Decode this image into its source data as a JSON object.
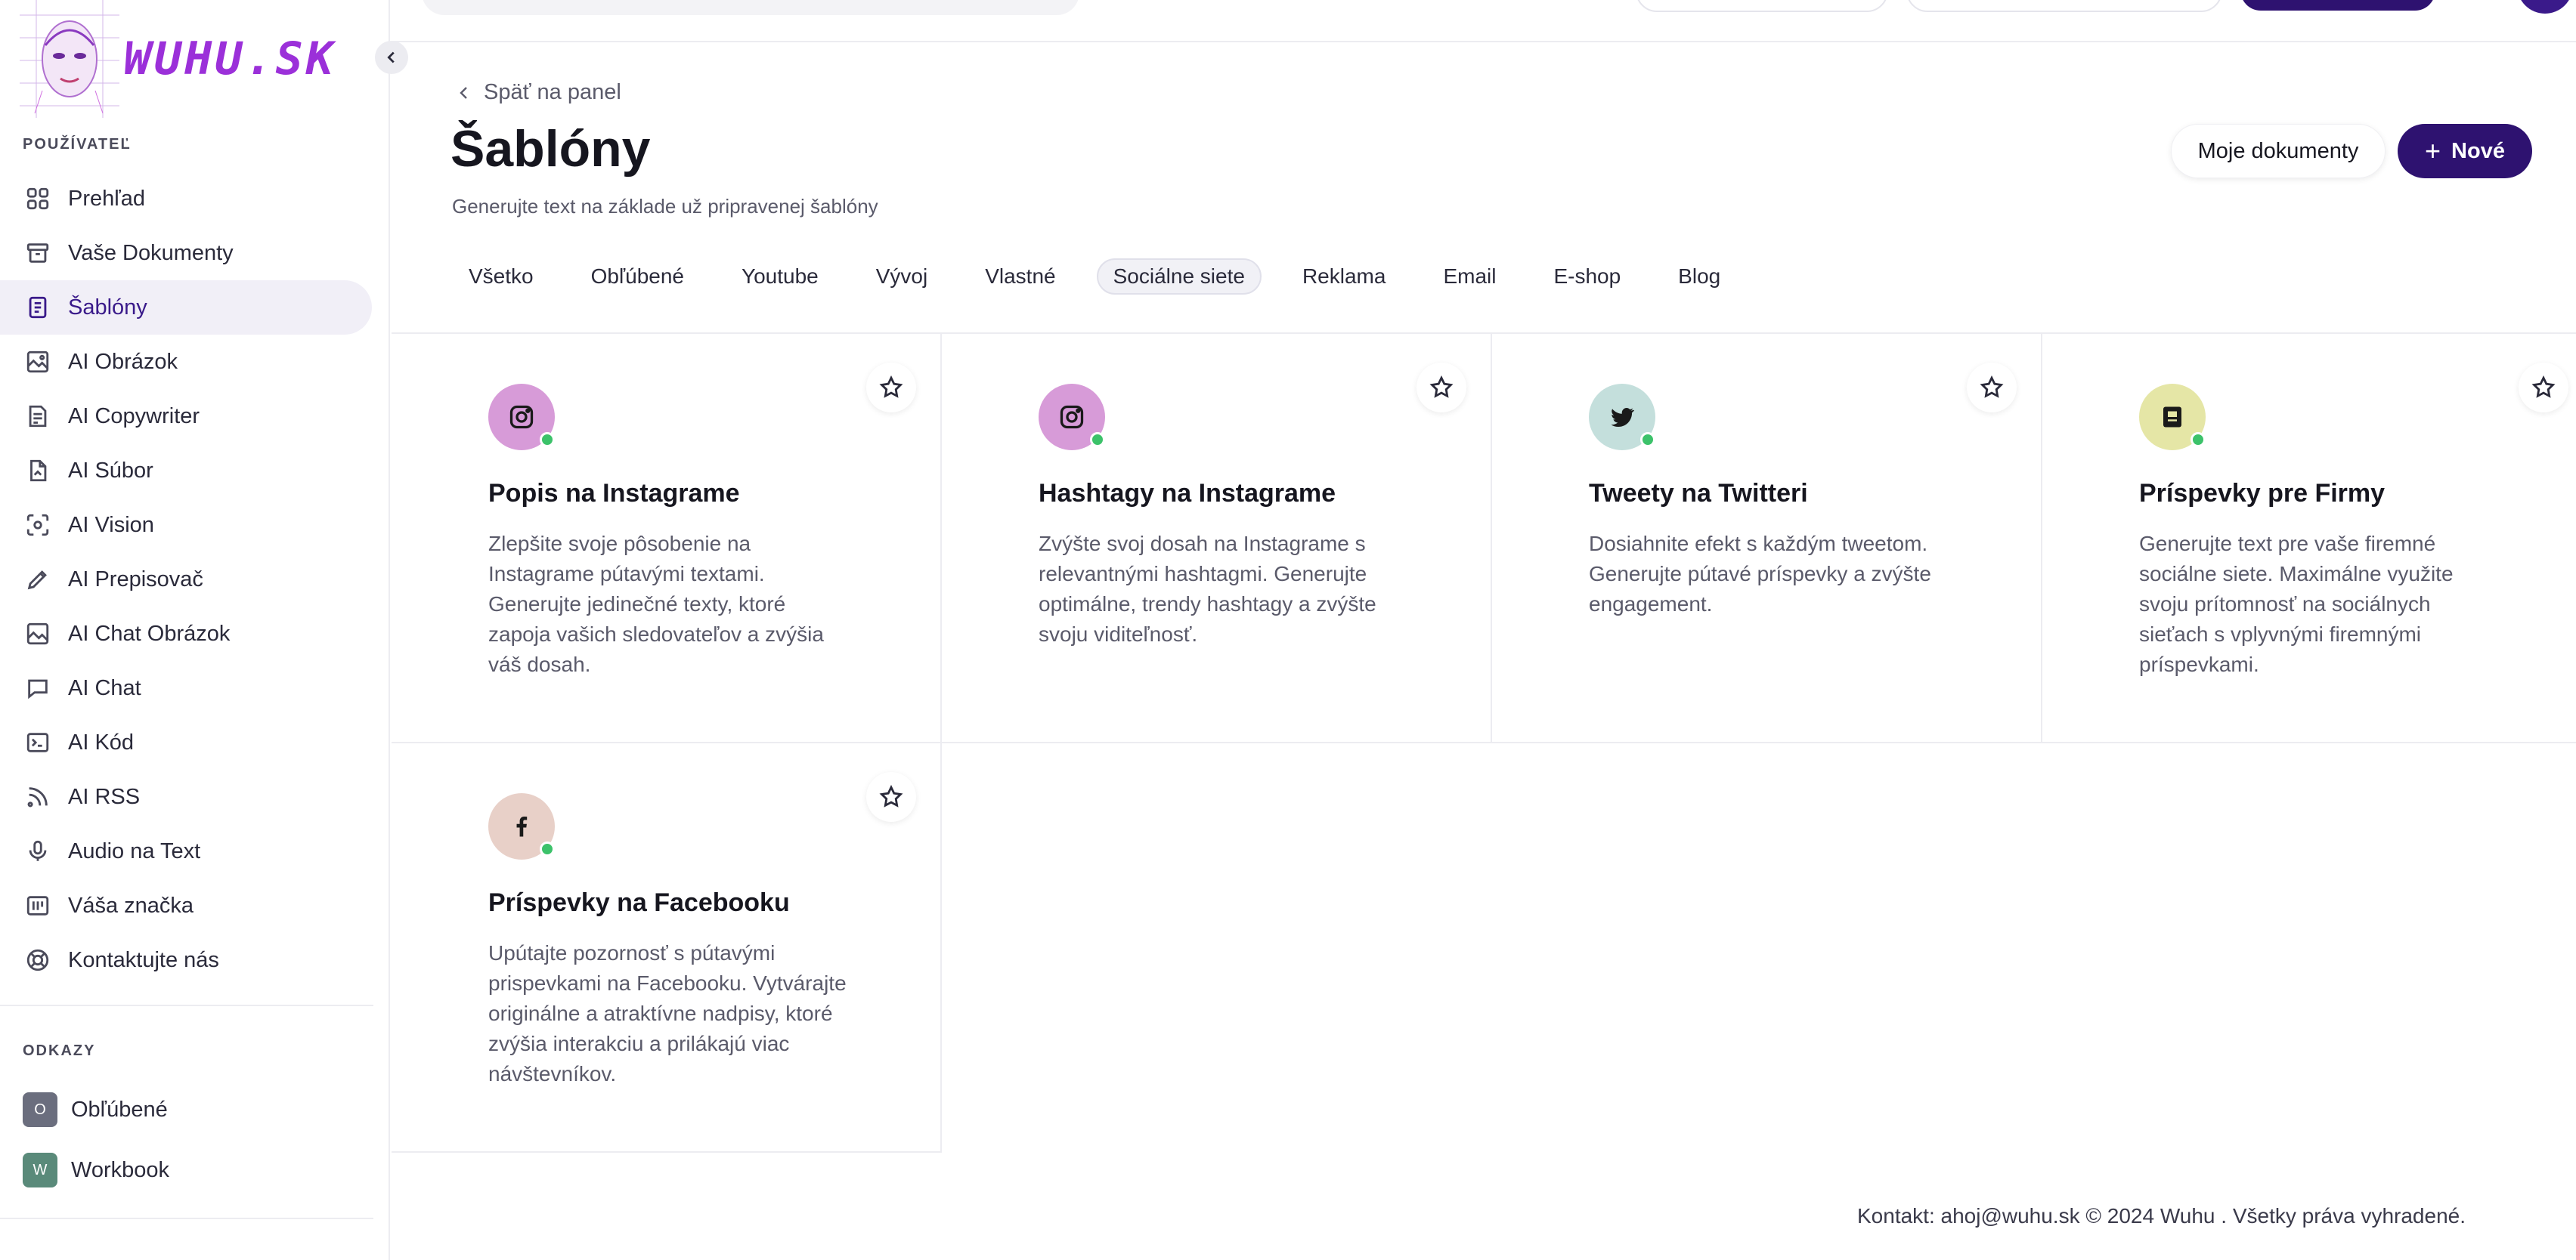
{
  "brand": {
    "logo_text": "WUHU.SK",
    "accent": "#9b30d9",
    "primary": "#2e1270"
  },
  "sidebar": {
    "section_user": "POUŽÍVATEĽ",
    "items": [
      {
        "label": "Prehľad",
        "icon": "dashboard-icon"
      },
      {
        "label": "Vaše Dokumenty",
        "icon": "archive-icon"
      },
      {
        "label": "Šablóny",
        "icon": "template-icon",
        "active": true
      },
      {
        "label": "AI Obrázok",
        "icon": "image-icon"
      },
      {
        "label": "AI Copywriter",
        "icon": "copywriter-icon"
      },
      {
        "label": "AI Súbor",
        "icon": "file-icon"
      },
      {
        "label": "AI Vision",
        "icon": "vision-icon"
      },
      {
        "label": "AI Prepisovač",
        "icon": "pencil-icon"
      },
      {
        "label": "AI Chat Obrázok",
        "icon": "image-chat-icon"
      },
      {
        "label": "AI Chat",
        "icon": "chat-icon"
      },
      {
        "label": "AI Kód",
        "icon": "terminal-icon"
      },
      {
        "label": "AI RSS",
        "icon": "rss-icon"
      },
      {
        "label": "Audio na Text",
        "icon": "microphone-icon"
      },
      {
        "label": "Váša značka",
        "icon": "brand-icon"
      },
      {
        "label": "Kontaktujte nás",
        "icon": "lifebuoy-icon"
      }
    ],
    "section_links": "ODKAZY",
    "links": [
      {
        "badge": "O",
        "label": "Obľúbené",
        "color": "#6b6e7e"
      },
      {
        "badge": "W",
        "label": "Workbook",
        "color": "#5a8a7a"
      }
    ]
  },
  "header": {
    "back_label": "Späť na panel",
    "title": "Šablóny",
    "subtitle": "Generujte text na základe už pripravenej šablóny",
    "docs_button": "Moje dokumenty",
    "new_button": "Nové"
  },
  "tabs": [
    {
      "label": "Všetko"
    },
    {
      "label": "Obľúbené"
    },
    {
      "label": "Youtube"
    },
    {
      "label": "Vývoj"
    },
    {
      "label": "Vlastné"
    },
    {
      "label": "Sociálne siete",
      "active": true
    },
    {
      "label": "Reklama"
    },
    {
      "label": "Email"
    },
    {
      "label": "E-shop"
    },
    {
      "label": "Blog"
    }
  ],
  "cards": [
    {
      "title": "Popis na Instagrame",
      "description": "Zlepšite svoje pôsobenie na Instagrame pútavými textami. Generujte jedinečné texty, ktoré zapoja vašich sledovateľov a zvýšia váš dosah.",
      "icon": "instagram-icon",
      "icon_bg": "#d79bd8"
    },
    {
      "title": "Hashtagy na Instagrame",
      "description": "Zvýšte svoj dosah na Instagrame s relevantnými hashtagmi. Generujte optimálne, trendy hashtagy a zvýšte svoju viditeľnosť.",
      "icon": "instagram-icon",
      "icon_bg": "#d79bd8"
    },
    {
      "title": "Tweety na Twitteri",
      "description": "Dosiahnite efekt s každým tweetom. Generujte pútavé príspevky a zvýšte engagement.",
      "icon": "twitter-icon",
      "icon_bg": "#c4dfdc"
    },
    {
      "title": "Príspevky pre Firmy",
      "description": "Generujte text pre vaše firemné sociálne siete. Maximálne využite svoju prítomnosť na sociálnych sieťach s vplyvnými firemnými príspevkami.",
      "icon": "business-icon",
      "icon_bg": "#e5e6a6"
    },
    {
      "title": "Príspevky na Facebooku",
      "description": "Upútajte pozornosť s pútavými prispevkami na Facebooku. Vytvárajte originálne a atraktívne nadpisy, ktoré zvýšia interakciu a prilákajú viac návštevníkov.",
      "icon": "facebook-icon",
      "icon_bg": "#e8d0c8"
    }
  ],
  "footer": {
    "text": "Kontakt: ahoj@wuhu.sk © 2024 Wuhu . Všetky práva vyhradené."
  }
}
